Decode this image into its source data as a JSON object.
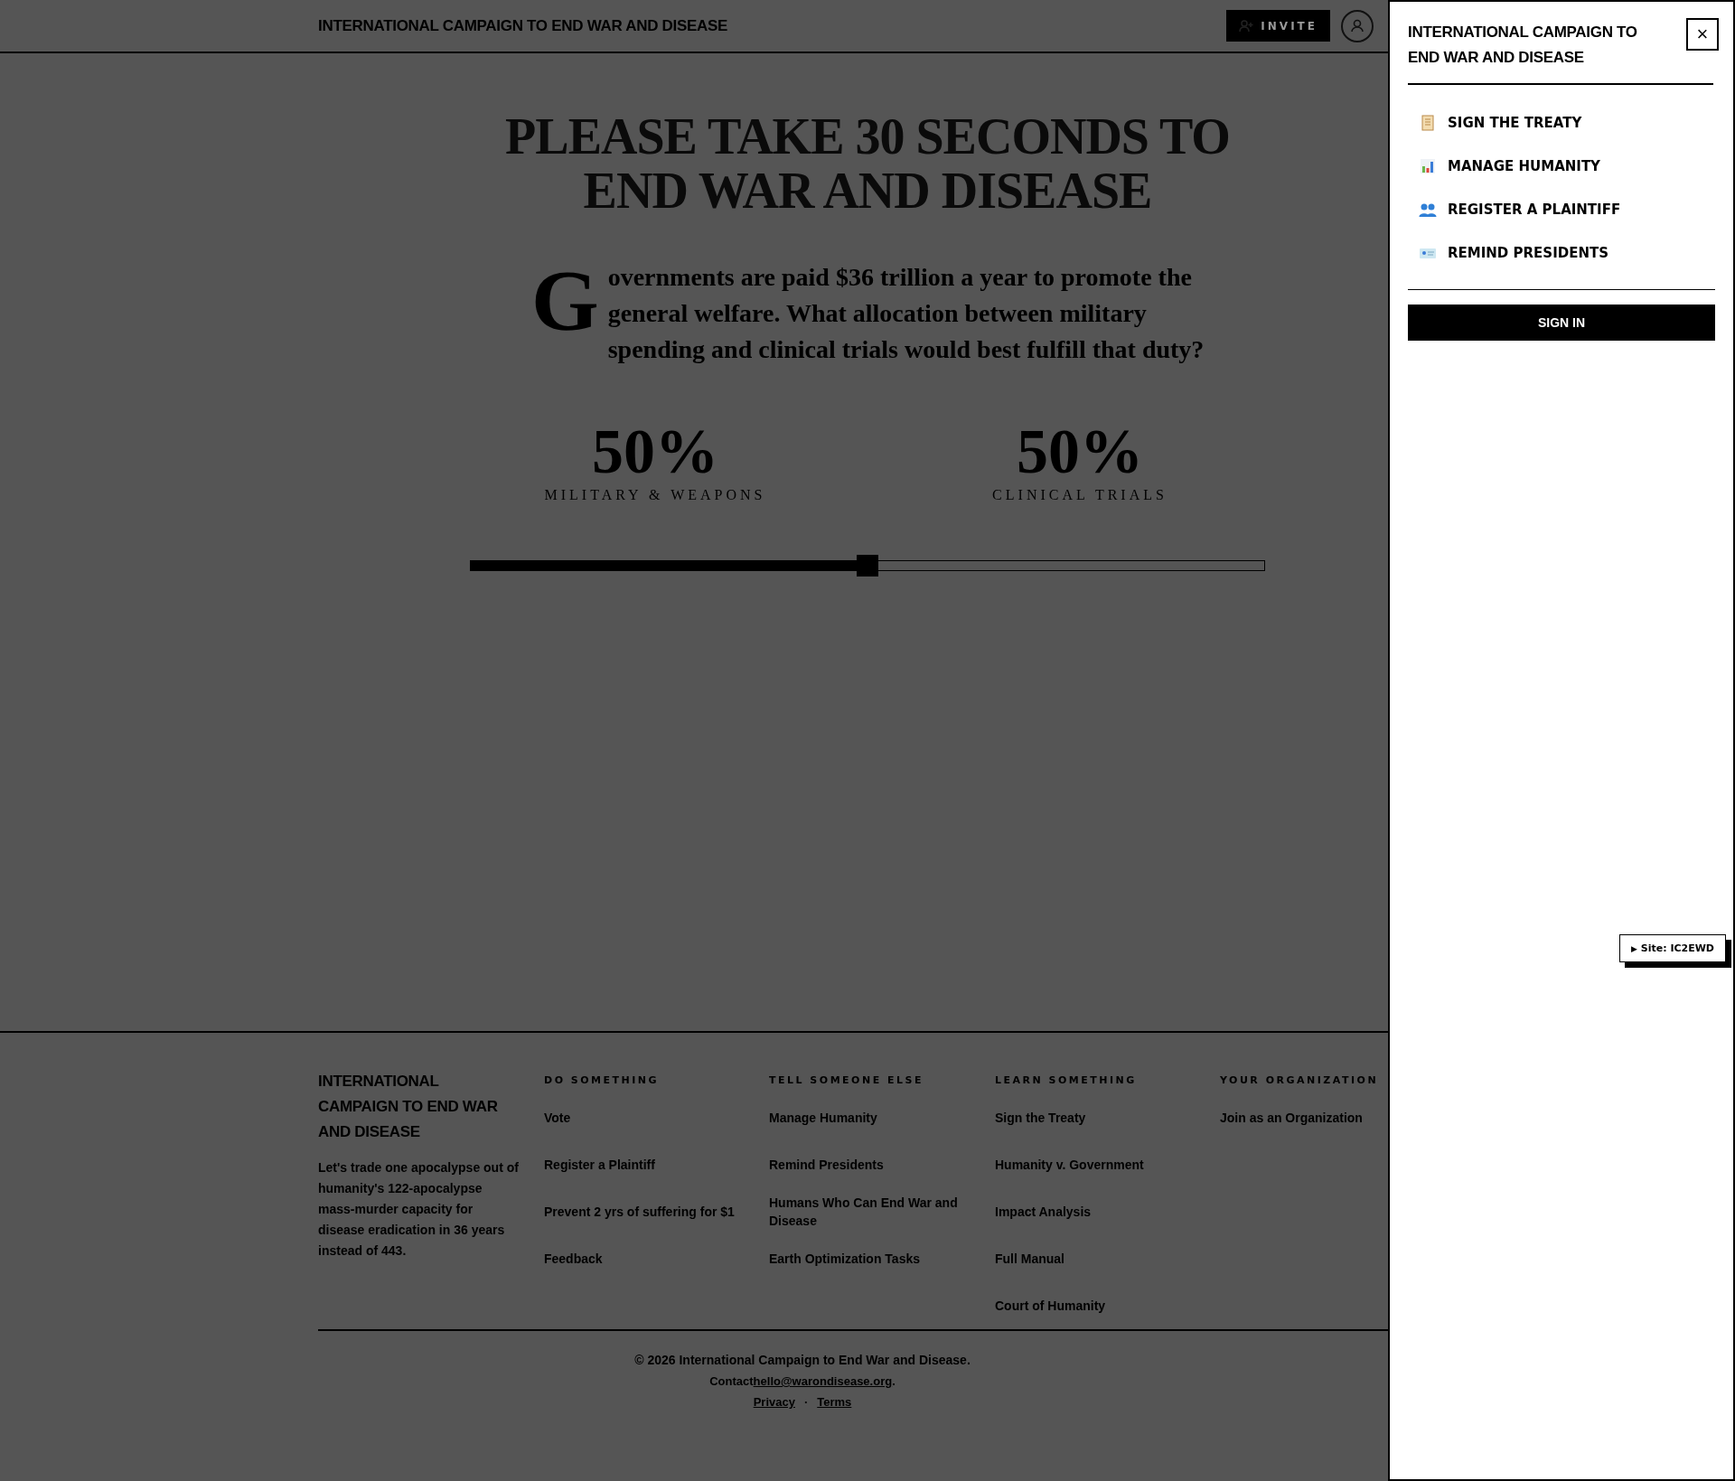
{
  "header": {
    "title": "INTERNATIONAL CAMPAIGN TO END WAR AND DISEASE",
    "invite_button": "INVITE"
  },
  "hero": {
    "title": "PLEASE TAKE 30 SECONDS TO END WAR AND DISEASE",
    "drop_cap": "G",
    "question": "overnments are paid $36 trillion a year to promote the general welfare. What allocation between military spending and clinical trials would best fulfill that duty?",
    "allocations": [
      {
        "percent": "50%",
        "label": "MILITARY & WEAPONS"
      },
      {
        "percent": "50%",
        "label": "CLINICAL TRIALS"
      }
    ],
    "slider": {
      "level": 0.5
    }
  },
  "footer": {
    "brand": "INTERNATIONAL CAMPAIGN TO END WAR AND DISEASE",
    "description": "Let's trade one apocalypse out of humanity's **122**-apocalypse mass-murder capacity for disease eradication in **36** years instead of **443**.",
    "columns": [
      {
        "heading": "DO SOMETHING",
        "links": [
          "Vote",
          "Register a Plaintiff",
          "Prevent 2 yrs of suffering for $1",
          "Feedback"
        ]
      },
      {
        "heading": "TELL SOMEONE ELSE",
        "links": [
          "Manage Humanity",
          "Remind Presidents",
          "Humans Who Can End War and Disease",
          "Earth Optimization Tasks"
        ]
      },
      {
        "heading": "LEARN SOMETHING",
        "links": [
          "Sign the Treaty",
          "Humanity v. Government",
          "Impact Analysis",
          "Full Manual",
          "Court of Humanity"
        ]
      },
      {
        "heading": "YOUR ORGANIZATION",
        "links": [
          "Join as an Organization"
        ]
      }
    ],
    "copyright": "© 2026 International Campaign to End War and Disease.",
    "contact_label": "Contact",
    "contact_email": "hello@warondisease.org",
    "contact_end": ".",
    "legal_links": [
      "Privacy",
      "Terms"
    ],
    "separator": "·"
  },
  "panel": {
    "title": "INTERNATIONAL CAMPAIGN TO END WAR AND DISEASE",
    "close": "×",
    "items": [
      {
        "kind": "scroll",
        "label": "SIGN THE TREATY"
      },
      {
        "kind": "chart",
        "label": "MANAGE HUMANITY"
      },
      {
        "kind": "people",
        "label": "REGISTER A PLAINTIFF"
      },
      {
        "kind": "card",
        "label": "REMIND PRESIDENTS"
      }
    ],
    "sign_in": "SIGN IN"
  },
  "site_badge": {
    "marker": "▶",
    "label": "Site: IC2EWD"
  }
}
